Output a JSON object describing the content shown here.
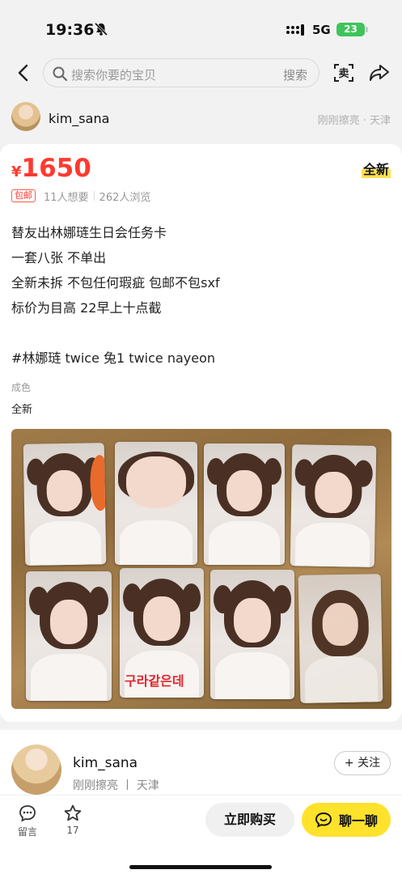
{
  "status_bar": {
    "time": "19:36",
    "network": "5G",
    "battery": "23"
  },
  "nav": {
    "search_placeholder": "搜索你要的宝贝",
    "search_button": "搜索",
    "sell_icon": "卖"
  },
  "seller_top": {
    "name": "kim_sana",
    "meta": "刚刚擦亮 · 天津"
  },
  "product": {
    "currency": "¥",
    "price": "1650",
    "condition_tag": "全新",
    "free_shipping": "包邮",
    "wants": "11人想要",
    "views": "262人浏览",
    "description": [
      "替友出林娜琏生日会任务卡",
      "一套八张 不单出",
      "全新未拆 不包任何瑕疵 包邮不包sxf",
      "标价为目高 22早上十点截",
      "",
      "#林娜琏 twice 兔1 twice nayeon"
    ],
    "condition_label": "成色",
    "condition_value": "全新",
    "photo_caption_overlay": "구라같은데"
  },
  "seller_bottom": {
    "name": "kim_sana",
    "meta": "刚刚擦亮 丨 天津",
    "follow_label": "+ 关注"
  },
  "bottom_bar": {
    "comment_label": "留言",
    "favorite_count": "17",
    "buy_label": "立即购买",
    "chat_label": "聊一聊"
  },
  "colors": {
    "price": "#ff3a2f",
    "accent_yellow": "#ffe22b",
    "battery": "#3ec45a"
  }
}
